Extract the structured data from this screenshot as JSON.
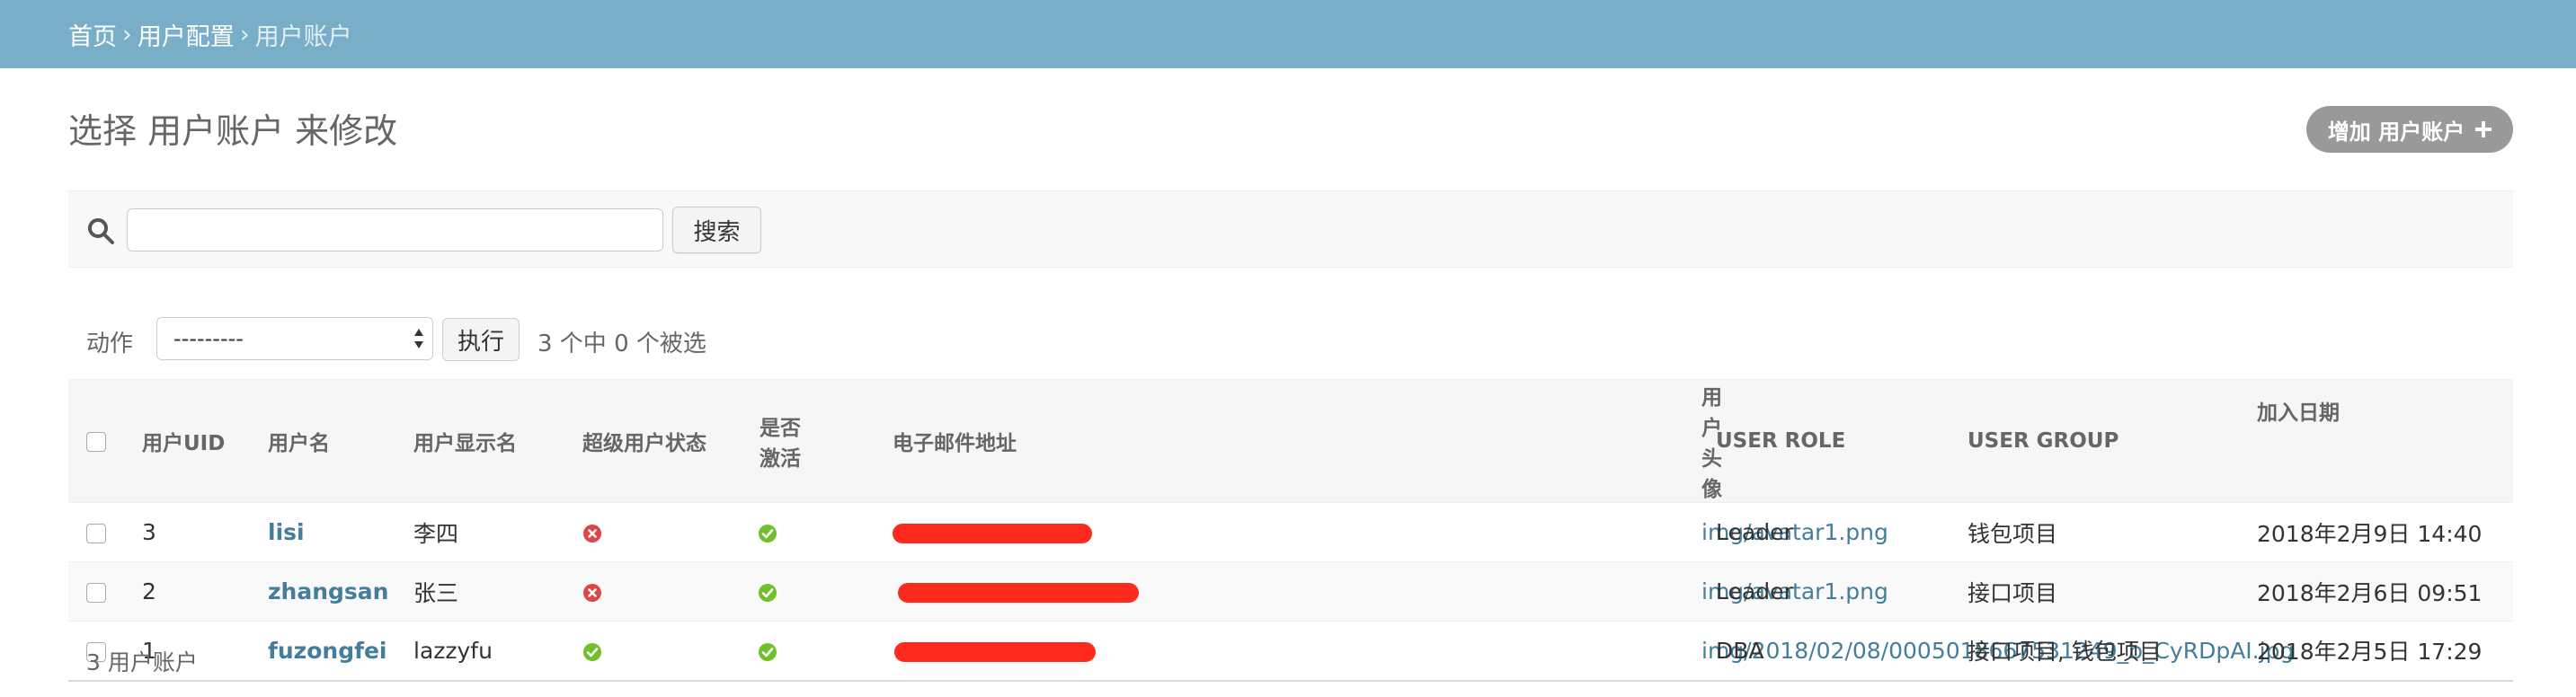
{
  "breadcrumbs": {
    "home": "首页",
    "section": "用户配置",
    "current": "用户账户",
    "separator": "›"
  },
  "page": {
    "title": "选择 用户账户 来修改",
    "add_button_label": "增加 用户账户"
  },
  "search": {
    "value": "",
    "button_label": "搜索"
  },
  "actions": {
    "label": "动作",
    "selected_option": "---------",
    "run_button_label": "执行",
    "selection_counter": "3 个中 0 个被选"
  },
  "table": {
    "headers": [
      "用户UID",
      "用户名",
      "用户显示名",
      "超级用户状态",
      "是否激活",
      "电子邮件地址",
      "用户头像",
      "USER ROLE",
      "USER GROUP",
      "加入日期"
    ],
    "rows": [
      {
        "uid": "3",
        "username": "lisi",
        "display_name": "李四",
        "superuser": false,
        "active": true,
        "avatar": "img/avatar1.png",
        "role": "Leader",
        "group": "钱包项目",
        "joined": "2018年2月9日 14:40"
      },
      {
        "uid": "2",
        "username": "zhangsan",
        "display_name": "张三",
        "superuser": false,
        "active": true,
        "avatar": "img/avatar1.png",
        "role": "Leader",
        "group": "接口项目",
        "joined": "2018年2月6日 09:51"
      },
      {
        "uid": "1",
        "username": "fuzongfei",
        "display_name": "lazzyfu",
        "superuser": true,
        "active": true,
        "avatar": "img/2018/02/08/0005018667531249_b_CyRDpAI.jpg",
        "role": "DBA",
        "group": "接口项目, 钱包项目",
        "joined": "2018年2月5日 17:29"
      }
    ]
  },
  "footer": {
    "count_label": "3 用户账户"
  },
  "colors": {
    "header_bar": "#79aec8",
    "link": "#447e9b",
    "yes_icon": "#70bf2b",
    "no_icon": "#dd4646",
    "redaction": "#ff2a1e"
  }
}
